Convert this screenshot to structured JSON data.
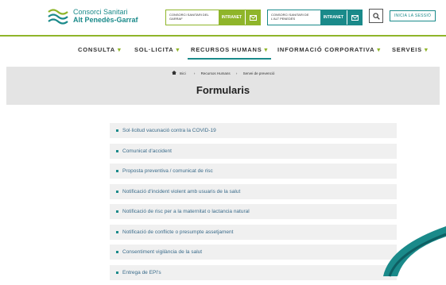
{
  "header": {
    "logo_line1": "Consorci Sanitari",
    "logo_line2": "Alt Penedès-Garraf",
    "intranet1_name": "CONSORCI SANITARI DEL GARRAF",
    "intranet1_tag": "INTRANET",
    "intranet2_name": "CONSORCI SANITARI DE L'ALT PENEDÈS",
    "intranet2_tag": "INTRANET",
    "login_label": "INICIA LA SESSIÓ"
  },
  "nav": {
    "items": [
      {
        "label": "CONSULTA"
      },
      {
        "label": "SOL·LICITA"
      },
      {
        "label": "RECURSOS HUMANS"
      },
      {
        "label": "INFORMACIÓ CORPORATIVA"
      },
      {
        "label": "SERVEIS"
      }
    ],
    "caret": "▾"
  },
  "breadcrumb": {
    "home": "Inici",
    "sep": "›",
    "level1": "Recursos Humans",
    "level2": "Servei de prevenció"
  },
  "page_title": "Formularis",
  "forms": [
    "Sol·licitud vacunació contra la COVID-19",
    "Comunicat d'accident",
    "Proposta preventiva / comunicat de risc",
    "Notificació d'incident violent amb usuaris de la salut",
    "Notificació de risc per a la maternitat o lactancia natural",
    "Notificació de conflicte o presumpte assetjament",
    "Consentiment vigilància de la salut",
    "Entrega de EPI's"
  ],
  "colors": {
    "accent_green": "#8fb52a",
    "accent_teal": "#1a8a8a"
  },
  "icons": [
    "logo-waves-icon",
    "mail-icon",
    "search-icon",
    "home-icon"
  ]
}
